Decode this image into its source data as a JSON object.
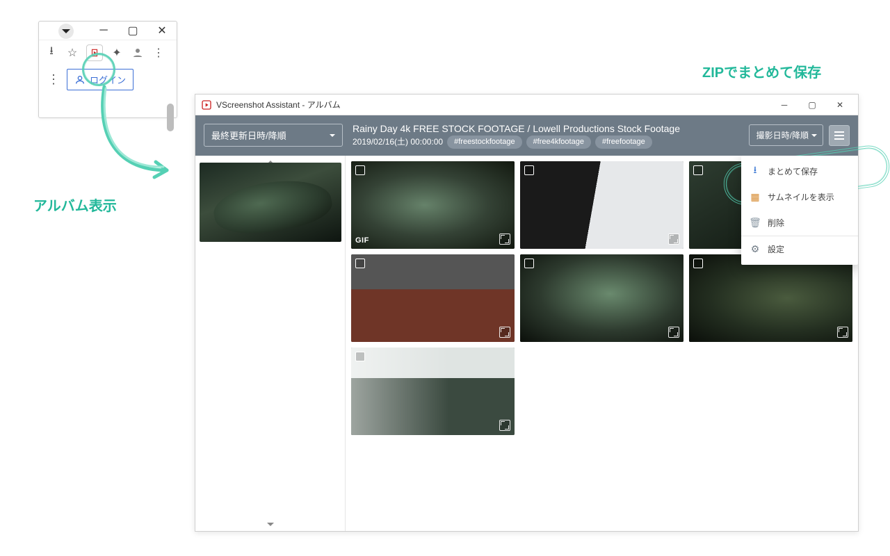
{
  "browser": {
    "login_label": "ログイン"
  },
  "annotations": {
    "album_view": "アルバム表示",
    "zip_save": "ZIPでまとめて保存"
  },
  "app": {
    "title": "VScreenshot Assistant - アルバム",
    "album_sort": "最終更新日時/降順",
    "shot_sort": "撮影日時/降順",
    "video_title": "Rainy Day 4k FREE STOCK FOOTAGE / Lowell Productions Stock Footage",
    "video_sub_date": "2019/02/16(土) 00:00:00",
    "tags": [
      "#freestockfootage",
      "#free4kfootage",
      "#freefootage"
    ],
    "gif_badge": "GIF",
    "menu": {
      "save_all": "まとめて保存",
      "show_thumbs": "サムネイルを表示",
      "delete": "削除",
      "settings": "設定"
    }
  }
}
